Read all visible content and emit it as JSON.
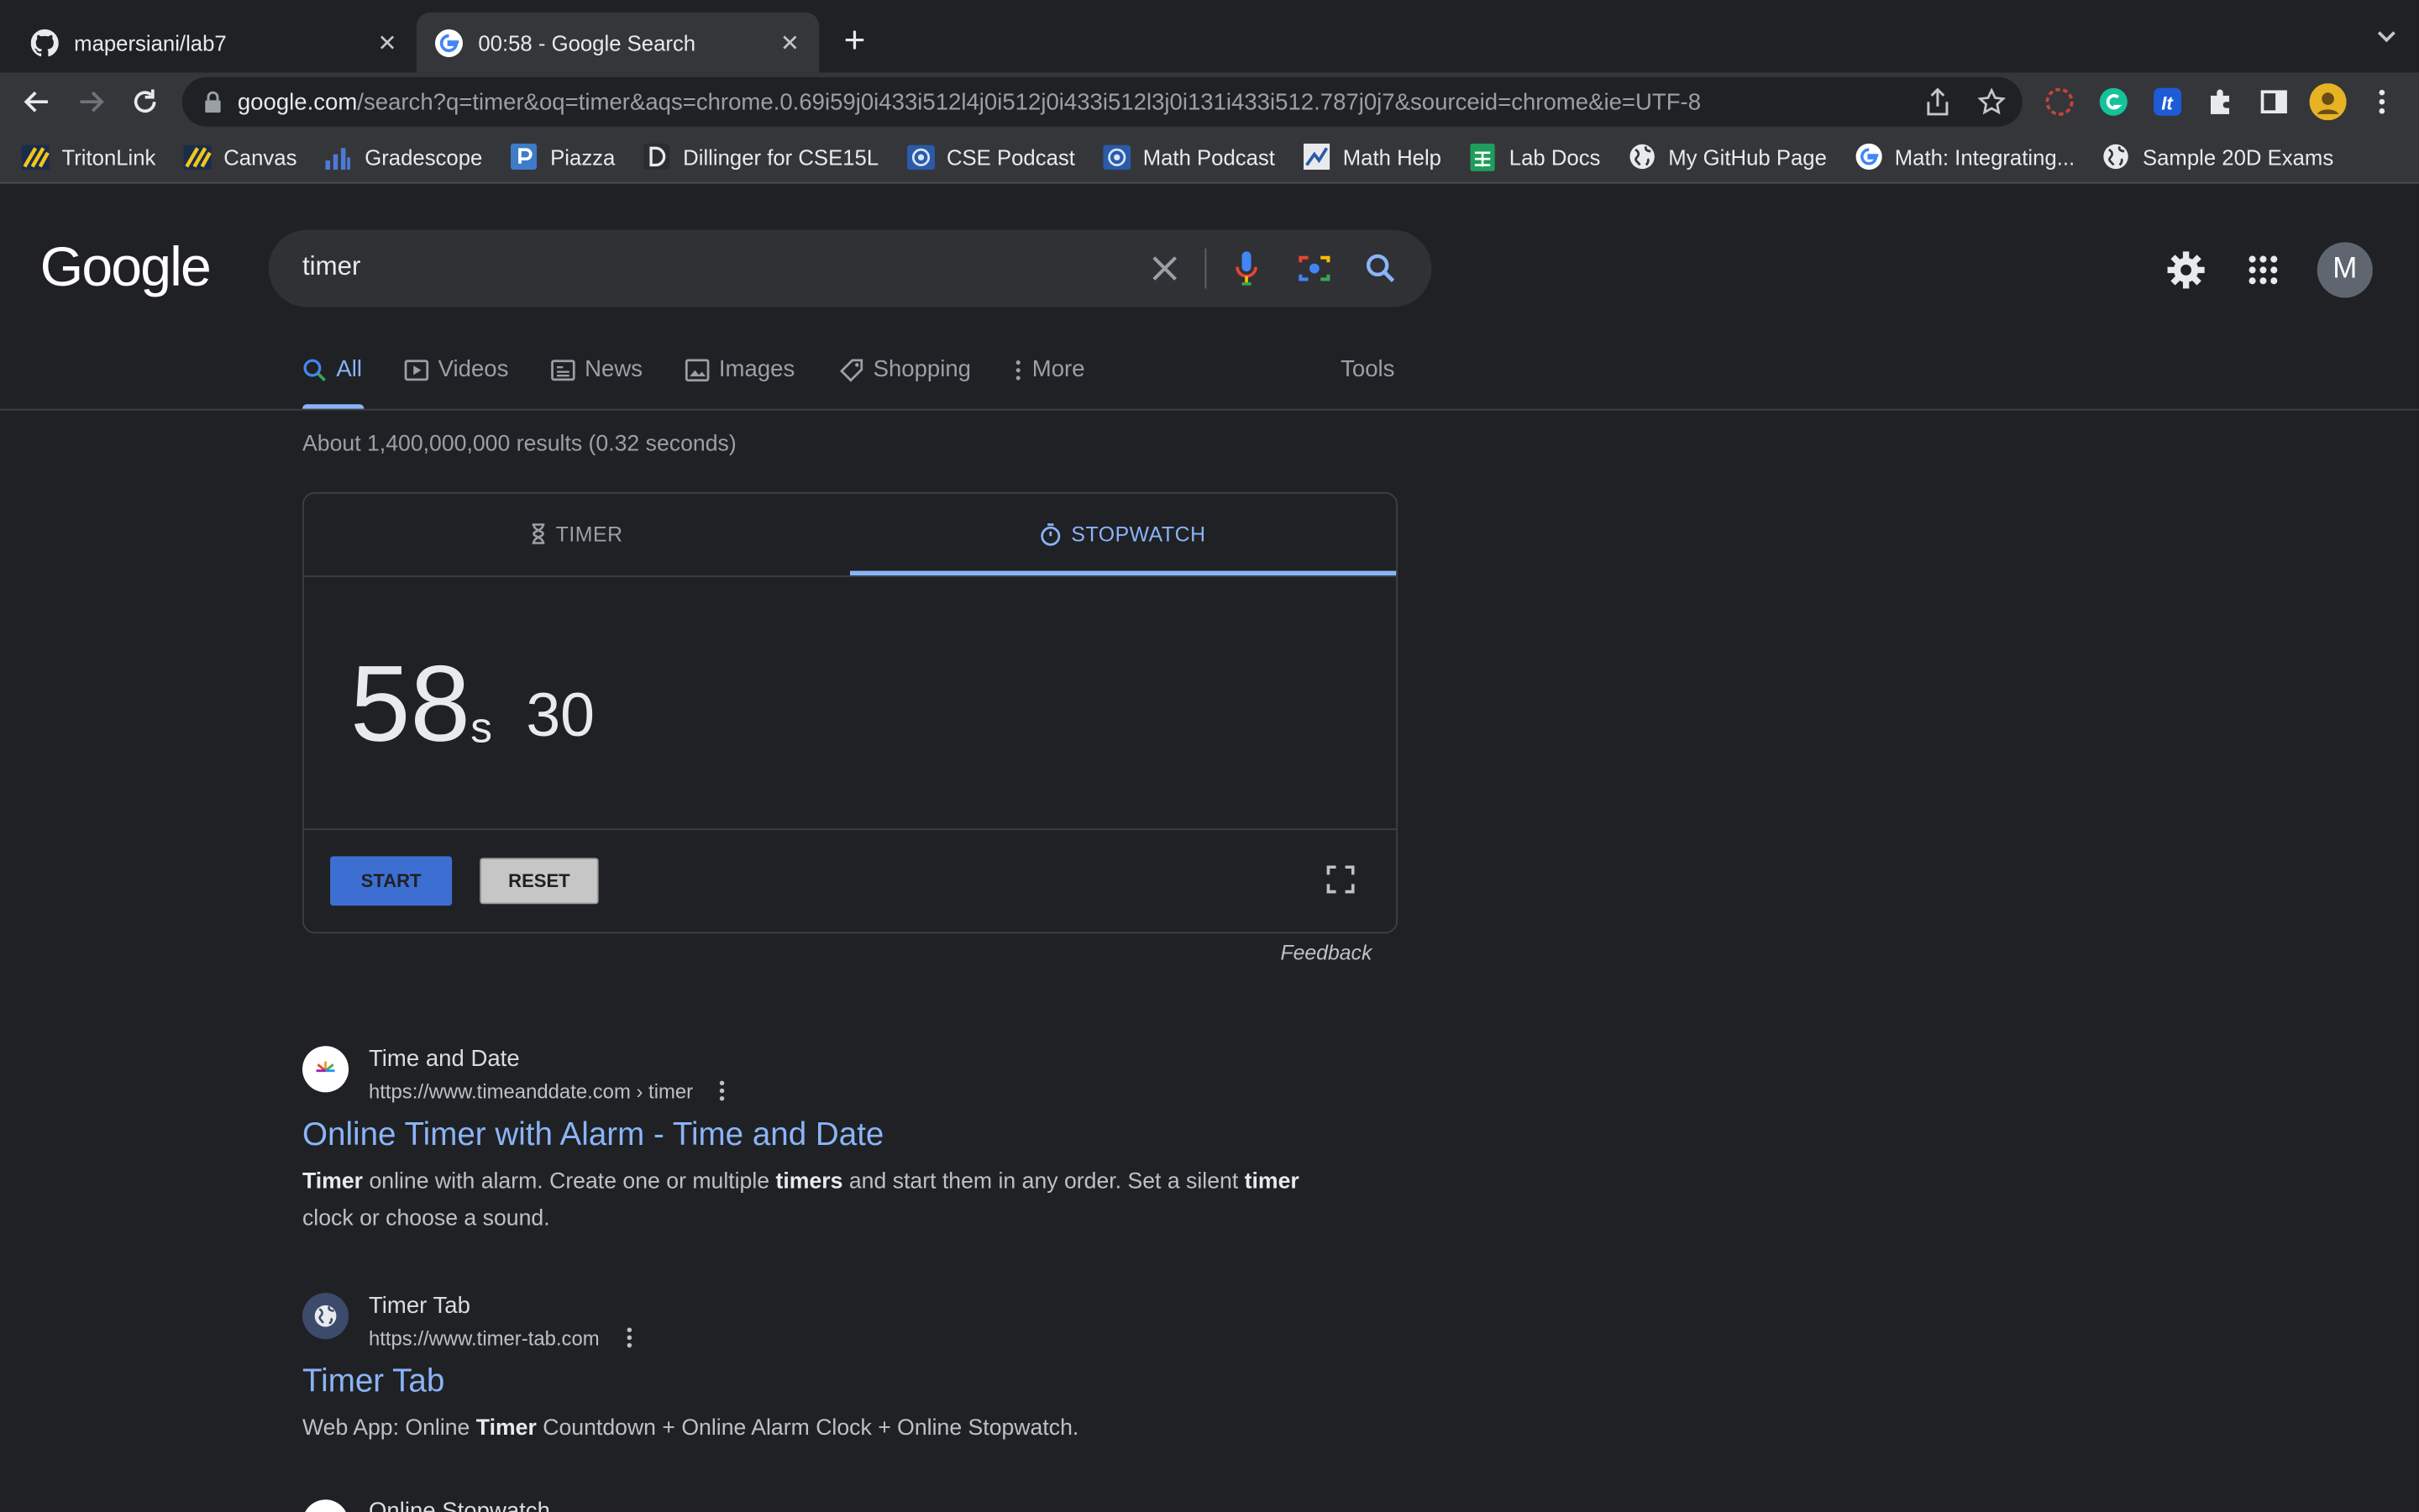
{
  "browser": {
    "tabs": [
      {
        "title": "mapersiani/lab7",
        "icon": "github-icon"
      },
      {
        "title": "00:58 - Google Search",
        "icon": "google-icon"
      }
    ],
    "close_glyph": "✕",
    "new_tab_glyph": "+",
    "url_host": "google.com",
    "url_path": "/search?q=timer&oq=timer&aqs=chrome.0.69i59j0i433i512l4j0i512j0i433i512l3j0i131i433i512.787j0j7&sourceid=chrome&ie=UTF-8",
    "bookmarks": [
      {
        "label": "TritonLink",
        "icon": "tritonlink-icon"
      },
      {
        "label": "Canvas",
        "icon": "canvas-icon"
      },
      {
        "label": "Gradescope",
        "icon": "gradescope-icon"
      },
      {
        "label": "Piazza",
        "icon": "piazza-icon"
      },
      {
        "label": "Dillinger for CSE15L",
        "icon": "dillinger-icon"
      },
      {
        "label": "CSE Podcast",
        "icon": "podcast-icon"
      },
      {
        "label": "Math Podcast",
        "icon": "podcast-icon"
      },
      {
        "label": "Math Help",
        "icon": "math-help-icon"
      },
      {
        "label": "Lab Docs",
        "icon": "sheets-icon"
      },
      {
        "label": "My GitHub Page",
        "icon": "globe-icon"
      },
      {
        "label": "Math: Integrating...",
        "icon": "google-icon"
      },
      {
        "label": "Sample 20D Exams",
        "icon": "globe-icon"
      }
    ]
  },
  "google": {
    "logo": "Google",
    "query": "timer",
    "avatar_letter": "M",
    "tabs": [
      {
        "label": "All",
        "active": true
      },
      {
        "label": "Videos"
      },
      {
        "label": "News"
      },
      {
        "label": "Images"
      },
      {
        "label": "Shopping"
      },
      {
        "label": "More"
      }
    ],
    "tools": "Tools",
    "stats": "About 1,400,000,000 results (0.32 seconds)"
  },
  "stopwatch": {
    "tab_timer": "TIMER",
    "tab_stopwatch": "STOPWATCH",
    "active_tab": "STOPWATCH",
    "seconds": "58",
    "seconds_unit": "s",
    "centiseconds": "30",
    "start": "START",
    "reset": "RESET",
    "feedback": "Feedback"
  },
  "results": [
    {
      "site": "Time and Date",
      "cite": "https://www.timeanddate.com › timer",
      "title": "Online Timer with Alarm - Time and Date",
      "snippet_html": "<b>Timer</b> online with alarm. Create one or multiple <b>timers</b> and start them in any order. Set a silent <b>timer</b> clock or choose a sound."
    },
    {
      "site": "Timer Tab",
      "cite": "https://www.timer-tab.com",
      "title": "Timer Tab",
      "snippet_html": "Web App: Online <b>Timer</b> Countdown + Online Alarm Clock + Online Stopwatch."
    },
    {
      "site": "Online Stopwatch"
    }
  ],
  "colors": {
    "background": "#202124",
    "link": "#8ab4f8",
    "accent_button": "#3c6fd1"
  }
}
